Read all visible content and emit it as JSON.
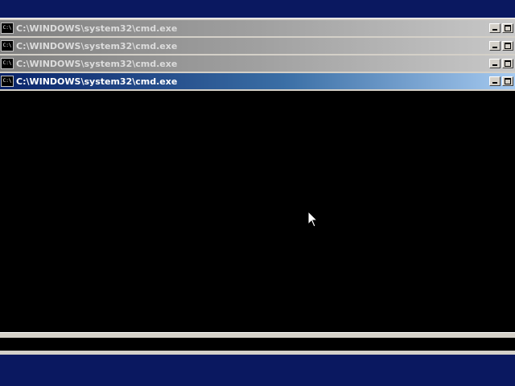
{
  "windows": [
    {
      "title": "C:\\WINDOWS\\system32\\cmd.exe",
      "icon": "C:\\",
      "state": "inactive"
    },
    {
      "title": "C:\\WINDOWS\\system32\\cmd.exe",
      "icon": "C:\\",
      "state": "inactive"
    },
    {
      "title": "C:\\WINDOWS\\system32\\cmd.exe",
      "icon": "C:\\",
      "state": "inactive"
    },
    {
      "title": "C:\\WINDOWS\\system32\\cmd.exe",
      "icon": "C:\\",
      "state": "active"
    }
  ],
  "colors": {
    "desktop": "#0a1860",
    "active_title_start": "#0a246a",
    "active_title_end": "#a6caf0",
    "inactive_title": "#808080",
    "console_bg": "#000000"
  },
  "icons": {
    "app": "cmd-icon",
    "minimize": "minimize-icon",
    "maximize": "maximize-icon",
    "pointer": "mouse-pointer-icon"
  }
}
